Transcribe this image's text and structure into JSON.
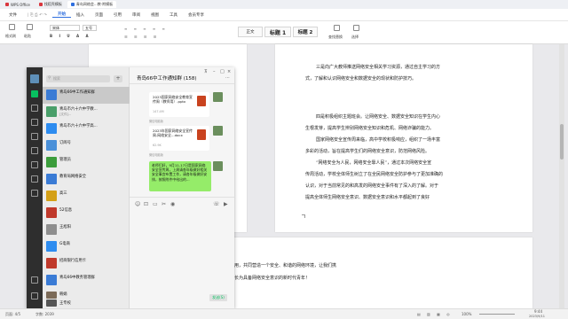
{
  "tabs": [
    {
      "label": "WPS Office",
      "color": "#d9363e",
      "active": false
    },
    {
      "label": "找稻壳模板",
      "color": "#d9363e",
      "active": false
    },
    {
      "label": "青岛网络会...教-附模板",
      "color": "#2f6fde",
      "active": true
    }
  ],
  "menu": {
    "file": "文件",
    "items": [
      "开始",
      "插入",
      "页面",
      "引用",
      "审阅",
      "视图",
      "工具",
      "会员专享"
    ]
  },
  "ribbon": {
    "paste": "格式刷",
    "paste2": "粘贴",
    "font": "宋体",
    "size": "五号",
    "styles": [
      "正文",
      "标题 1",
      "标题 2"
    ],
    "find": "查找替换",
    "select": "选择"
  },
  "doc": {
    "page2": [
      "三是向广大教师推送网络安全相关学习资源，通过自主学习的方",
      "式，了解和认识网络安全和数据安全的现状和防护技巧。",
      "四是积极组织主题班会。让网络安全、数据安全知识在学生内心",
      "生根发芽，提高学生辨别网络安全知识和危机、网络诈骗的能力。",
      "国家网络安全宣传周来临，高中学校积极响应，组织了一场丰富",
      "多彩的活动，旨在提高学生们的网络安全意识，防范网络风险。",
      "“网络安全为人民，网络安全靠人民”，通过本次网络安全宣",
      "传周活动，学校全体师生树立了在全民网络安全防护参与了更加准确的",
      "认识，对于当前常见的和高发的网络安全事件有了深入的了解。对于",
      "提高全体师生网络安全意识、数据安全意识和水平都起到了良好"
    ],
    "page3": [
      "用，共同营造一个安全、和谐的网络环境，让我们携",
      "长为具备网络安全意识的新时代青年！"
    ]
  },
  "wechat": {
    "search_placeholder": "搜索",
    "plus": "+",
    "conversations": [
      {
        "name": "青岛66中工作通知群",
        "preview": "",
        "time": "",
        "color": "#3a7bd5",
        "active": true
      },
      {
        "name": "青岛市六十六中学教...",
        "preview": "[文件]...",
        "time": "",
        "color": "#4a9f6a",
        "active": false
      },
      {
        "name": "青岛市六十六中学高...",
        "preview": "",
        "time": "",
        "color": "#2d8cf0",
        "active": false
      },
      {
        "name": "订阅号",
        "preview": "",
        "time": "",
        "color": "#4a90d9",
        "active": false
      },
      {
        "name": "管理员",
        "preview": "",
        "time": "",
        "color": "#3c9d3c",
        "active": false
      },
      {
        "name": "教育局网络安全",
        "preview": "",
        "time": "",
        "color": "#3a7bd5",
        "active": false
      },
      {
        "name": "高三",
        "preview": "",
        "time": "",
        "color": "#d4a017",
        "active": false
      },
      {
        "name": "52信息",
        "preview": "",
        "time": "",
        "color": "#c0392b",
        "active": false
      },
      {
        "name": "王旭阳",
        "preview": "",
        "time": "",
        "color": "#8e8e8e",
        "active": false
      },
      {
        "name": "G电商",
        "preview": "",
        "time": "",
        "color": "#2d8cf0",
        "active": false
      },
      {
        "name": "招商银行信用卡",
        "preview": "",
        "time": "",
        "color": "#c0392b",
        "active": false
      },
      {
        "name": "青岛66中教务管理群",
        "preview": "",
        "time": "",
        "color": "#3a7bd5",
        "active": false
      },
      {
        "name": "韩娟",
        "preview": "",
        "time": "",
        "color": "#7b6a58",
        "active": false
      },
      {
        "name": "王专校",
        "preview": "",
        "time": "",
        "color": "#555555",
        "active": false
      }
    ],
    "chat_title": "青岛66中工作通知群 (158)",
    "files": [
      {
        "title": "2023国家网络安全教育宣传周（教师用）.pptx",
        "size": "147.4M",
        "origin": "微信电脑版"
      },
      {
        "title": "2023年国家网络安全宣传周-网络安全...docx",
        "size": "62.9K",
        "origin": "微信电脑版"
      }
    ],
    "green_message": "老师们好，9月11-17日是国家网络安全宣传周，上周请各年级做好相关安全事宜布置工作，请各年级做好安排，按照附件中给出的...",
    "send": "发送(S)"
  },
  "statusbar": {
    "page": "页面: 4/5",
    "words": "字数: 2039",
    "zoom": "100%",
    "time": "9:44",
    "date": "2023/9/11"
  }
}
